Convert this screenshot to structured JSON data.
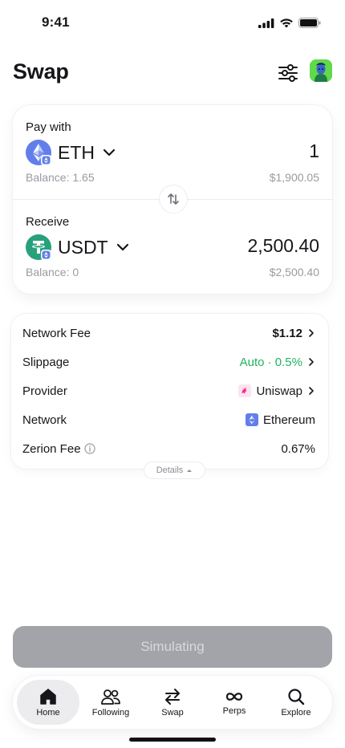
{
  "status": {
    "time": "9:41"
  },
  "header": {
    "title": "Swap"
  },
  "pay": {
    "label": "Pay with",
    "token": "ETH",
    "amount": "1",
    "balance": "Balance: 1.65",
    "fiat": "$1,900.05"
  },
  "receive": {
    "label": "Receive",
    "token": "USDT",
    "amount": "2,500.40",
    "balance": "Balance: 0",
    "fiat": "$2,500.40"
  },
  "details": {
    "rows": [
      {
        "label": "Network Fee",
        "value": "$1.12"
      },
      {
        "label": "Slippage",
        "value": "Auto · 0.5%"
      },
      {
        "label": "Provider",
        "value": "Uniswap"
      },
      {
        "label": "Network",
        "value": "Ethereum"
      },
      {
        "label": "Zerion Fee",
        "value": "0.67%"
      }
    ],
    "toggle_label": "Details"
  },
  "cta": {
    "label": "Simulating"
  },
  "tabs": [
    {
      "label": "Home",
      "icon": "home-icon"
    },
    {
      "label": "Following",
      "icon": "following-icon"
    },
    {
      "label": "Swap",
      "icon": "swap-icon"
    },
    {
      "label": "Perps",
      "icon": "infinity-icon"
    },
    {
      "label": "Explore",
      "icon": "search-icon"
    }
  ],
  "colors": {
    "eth": "#627eea",
    "usdt": "#26a17b",
    "green": "#22b35e",
    "cta_disabled": "#a3a4a9"
  }
}
